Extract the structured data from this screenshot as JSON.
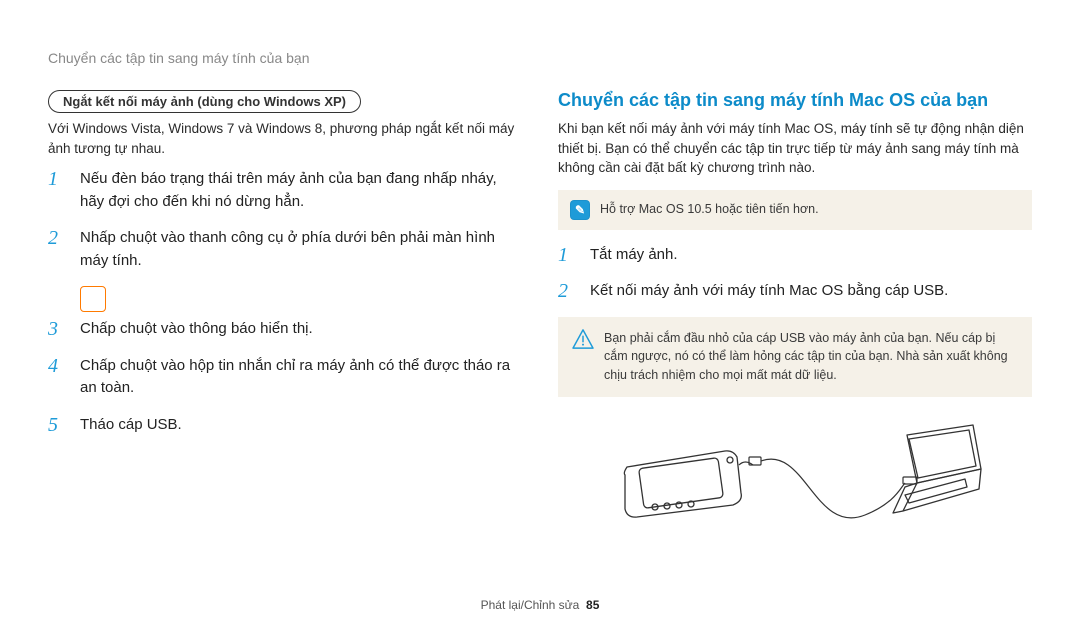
{
  "breadcrumb": "Chuyển các tập tin sang máy tính của bạn",
  "left": {
    "pill": "Ngắt kết nối máy ảnh (dùng cho Windows XP)",
    "intro": "Với Windows Vista, Windows 7 và Windows 8, phương pháp ngắt kết nối máy ảnh tương tự nhau.",
    "steps": [
      "Nếu đèn báo trạng thái trên máy ảnh của bạn đang nhấp nháy, hãy đợi cho đến khi nó dừng hẳn.",
      "Nhấp chuột       vào thanh công cụ ở phía dưới bên phải màn hình máy tính.",
      "Chấp chuột vào thông báo hiển thị.",
      "Chấp chuột vào hộp tin nhắn chỉ ra máy ảnh có thể được tháo ra an toàn.",
      "Tháo cáp USB."
    ]
  },
  "right": {
    "heading": "Chuyển các tập tin sang máy tính Mac OS của bạn",
    "intro": "Khi bạn kết nối máy ảnh với máy tính Mac OS, máy tính sẽ tự động nhận diện thiết bị. Bạn có thể chuyển các tập tin trực tiếp từ máy ảnh sang máy tính mà không cần cài đặt bất kỳ chương trình nào.",
    "note": "Hỗ trợ Mac OS 10.5 hoặc tiên tiến hơn.",
    "steps": [
      "Tắt máy ảnh.",
      "Kết nối máy ảnh với máy tính Mac OS bằng cáp USB."
    ],
    "warning": "Bạn phải cắm đầu nhỏ của cáp USB vào máy ảnh của bạn. Nếu cáp bị cắm ngược, nó có thể làm hỏng các tập tin của bạn. Nhà sản xuất không chịu trách nhiệm cho mọi mất mát dữ liệu."
  },
  "footer": {
    "section": "Phát lại/Chỉnh sửa",
    "page": "85"
  }
}
